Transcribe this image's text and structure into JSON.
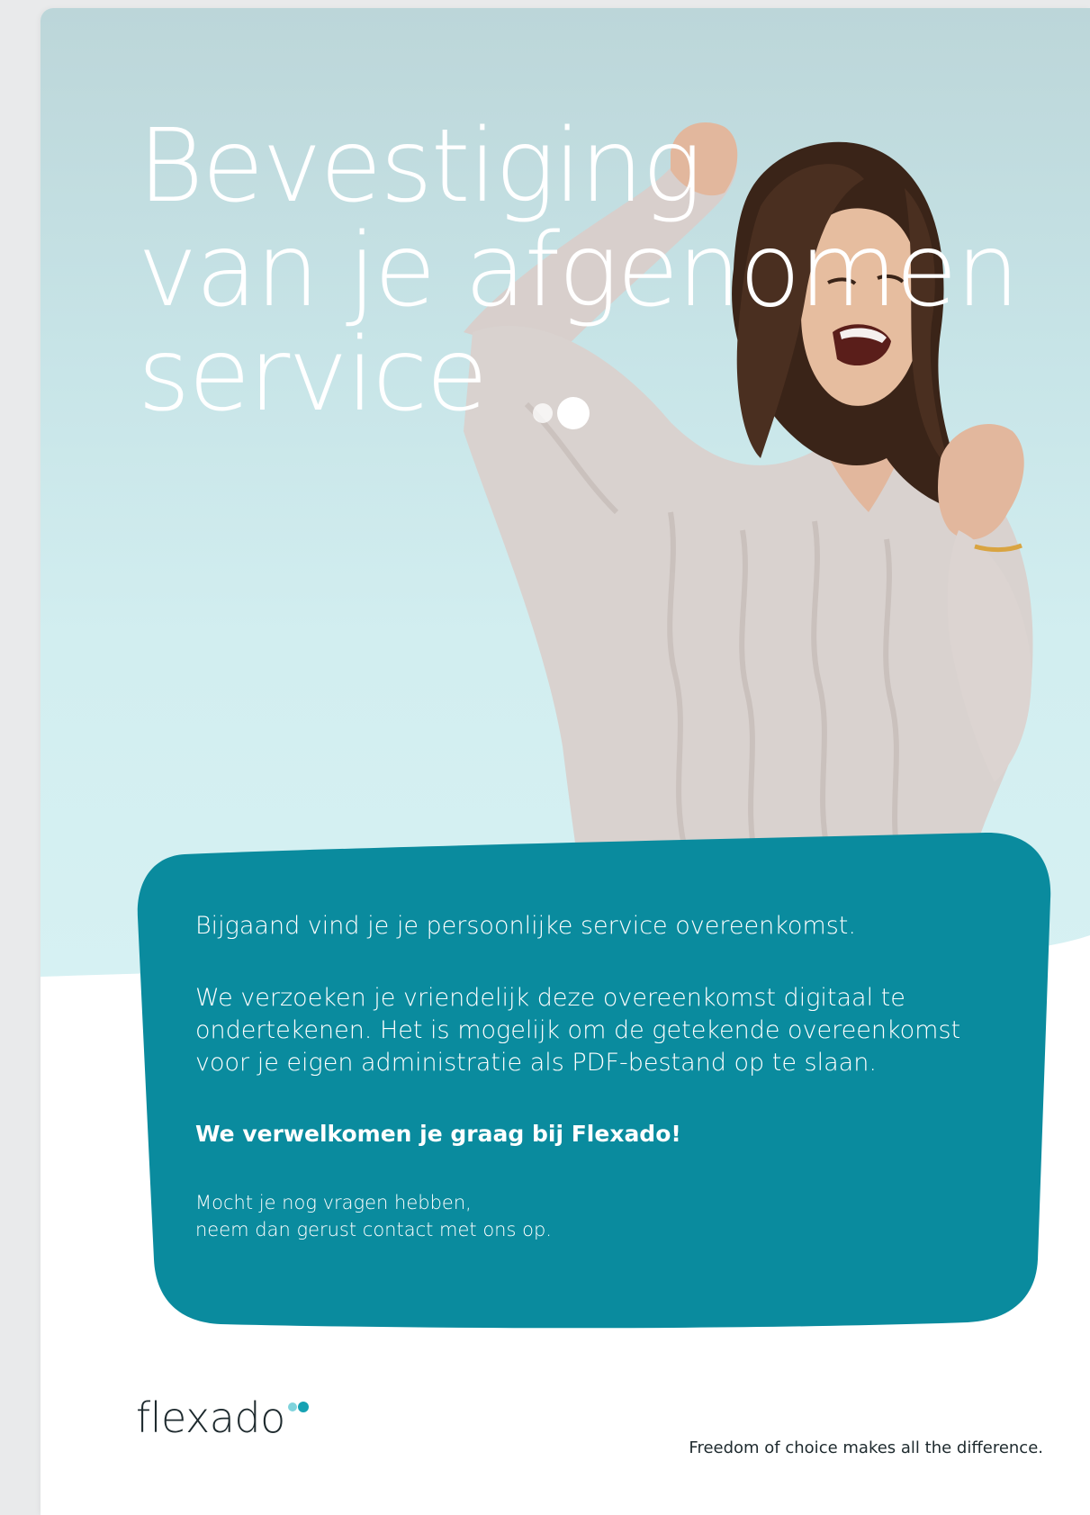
{
  "hero": {
    "title_lines": [
      "Bevestiging",
      "van je afgenomen",
      "service"
    ]
  },
  "card": {
    "intro": "Bijgaand vind je je persoonlijke service overeenkomst.",
    "request": "We verzoeken je vriendelijk deze overeenkomst digitaal te ondertekenen. Het is mogelijk om de getekende overeenkomst voor je eigen administratie als PDF-bestand op te slaan.",
    "welcome": "We verwelkomen je graag bij Flexado!",
    "contact_lines": [
      "Mocht je nog vragen hebben,",
      "neem dan gerust contact met ons op."
    ]
  },
  "footer": {
    "logo_text": "flexado",
    "tagline": "Freedom of choice makes all the difference."
  },
  "colors": {
    "card": "#0a8b9e",
    "logo_dot_teal": "#16a2b3",
    "logo_dot_light": "#7fd3dc"
  }
}
